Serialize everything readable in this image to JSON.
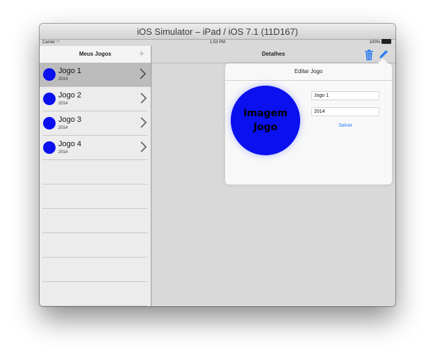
{
  "window": {
    "title": "iOS Simulator – iPad / iOS 7.1 (11D167)"
  },
  "status_bar": {
    "carrier": "Carrier",
    "time": "1:53 PM",
    "battery": "100%"
  },
  "master": {
    "title": "Meus Jogos",
    "add_icon": "plus-icon",
    "items": [
      {
        "name": "Jogo 1",
        "year": "2014",
        "selected": true
      },
      {
        "name": "Jogo 2",
        "year": "2014",
        "selected": false
      },
      {
        "name": "Jogo 3",
        "year": "2014",
        "selected": false
      },
      {
        "name": "Jogo 4",
        "year": "2014",
        "selected": false
      }
    ]
  },
  "detail": {
    "title": "Detalhes",
    "trash_icon": "trash-icon",
    "edit_icon": "pencil-icon"
  },
  "popover": {
    "title": "Editar Jogo",
    "image_label": "Imagem Jogo",
    "name_value": "Jogo 1",
    "year_value": "2014",
    "save_label": "Salvar"
  },
  "colors": {
    "accent": "#2a7df2",
    "thumbnail": "#0a10ee",
    "selected_row": "#bcbcbc"
  }
}
